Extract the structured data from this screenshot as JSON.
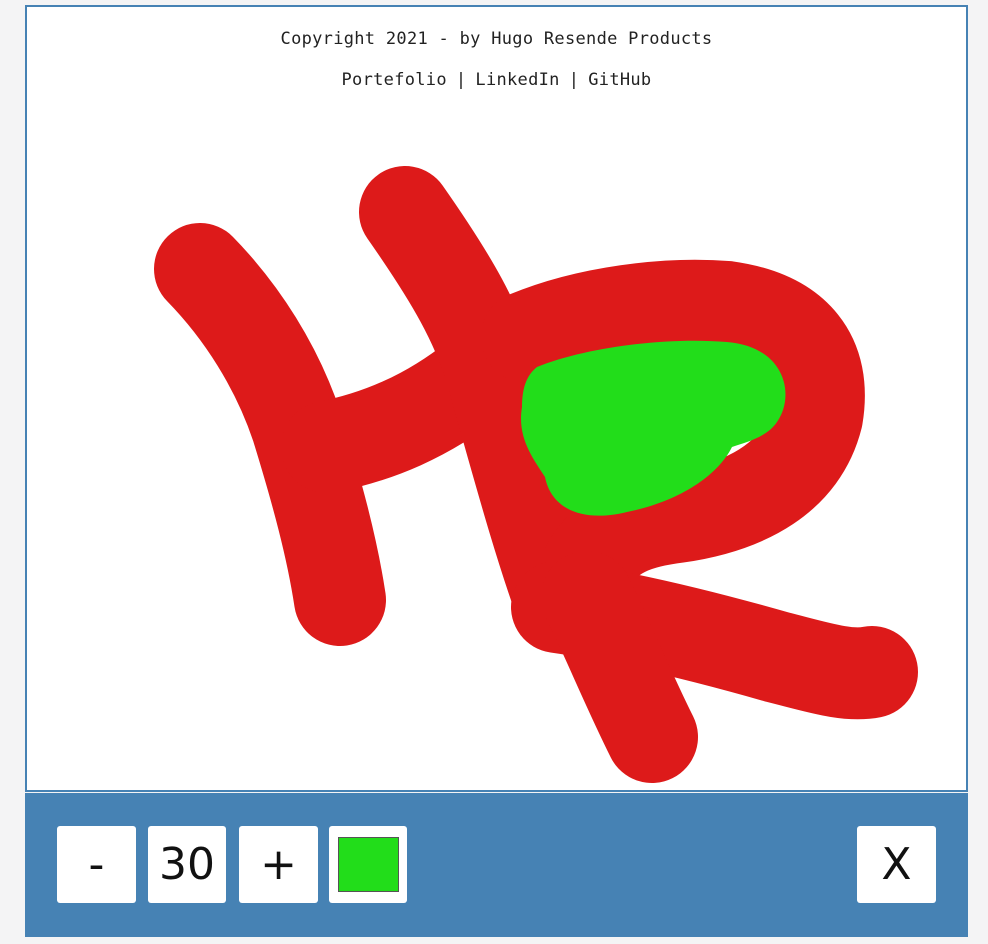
{
  "footer": {
    "copyright": "Copyright 2021 - by Hugo Resende Products",
    "links": [
      "Portefolio",
      "LinkedIn",
      "GitHub"
    ],
    "separator": "|"
  },
  "toolbar": {
    "decrease_label": "-",
    "brush_size": "30",
    "increase_label": "+",
    "current_color": "#22dd1a",
    "close_label": "X"
  },
  "drawing": {
    "stroke_colors": [
      "#dd1a1a",
      "#22dd1a"
    ]
  }
}
